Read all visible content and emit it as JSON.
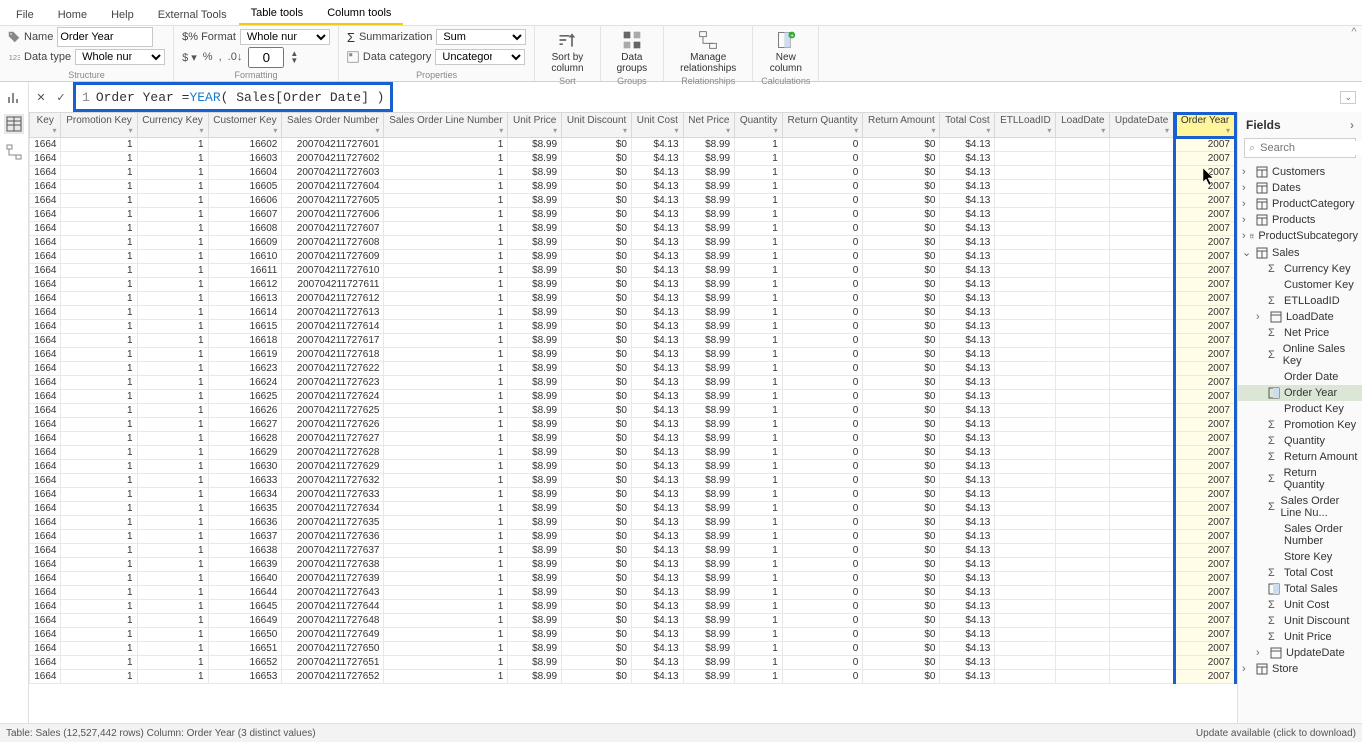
{
  "menuTabs": [
    {
      "label": "File"
    },
    {
      "label": "Home"
    },
    {
      "label": "Help"
    },
    {
      "label": "External Tools"
    },
    {
      "label": "Table tools",
      "active": true
    },
    {
      "label": "Column tools",
      "open": true
    }
  ],
  "ribbon": {
    "name": {
      "label": "Name",
      "value": "Order Year"
    },
    "dataType": {
      "label": "Data type",
      "value": "Whole number"
    },
    "formatLbl": "Format",
    "formatVal": "Whole number",
    "decimals": "0",
    "summarization": {
      "label": "Summarization",
      "value": "Sum"
    },
    "dataCategory": {
      "label": "Data category",
      "value": "Uncategorized"
    },
    "sortBy": "Sort by\ncolumn",
    "sortGrp": "Sort",
    "dataGroups": "Data\ngroups",
    "groupsGrp": "Groups",
    "manageRel": "Manage\nrelationships",
    "relGrp": "Relationships",
    "newCol": "New\ncolumn",
    "calcGrp": "Calculations",
    "structureGrp": "Structure",
    "formattingGrp": "Formatting",
    "propertiesGrp": "Properties"
  },
  "formula": {
    "line": "1",
    "prefix": "Order Year = ",
    "fn": "YEAR",
    "arg": " ( Sales[Order Date] )"
  },
  "columns": [
    "Key",
    "Promotion Key",
    "Currency Key",
    "Customer Key",
    "Sales Order Number",
    "Sales Order Line Number",
    "Unit Price",
    "Unit Discount",
    "Unit Cost",
    "Net Price",
    "Quantity",
    "Return Quantity",
    "Return Amount",
    "Total Cost",
    "ETLLoadID",
    "LoadDate",
    "UpdateDate",
    "Order Year"
  ],
  "rows": [
    [
      "1664",
      "1",
      "1",
      "16602",
      "200704211727601",
      "1",
      "$8.99",
      "$0",
      "$4.13",
      "$8.99",
      "1",
      "0",
      "$0",
      "$4.13",
      "",
      "",
      "",
      "2007"
    ],
    [
      "1664",
      "1",
      "1",
      "16603",
      "200704211727602",
      "1",
      "$8.99",
      "$0",
      "$4.13",
      "$8.99",
      "1",
      "0",
      "$0",
      "$4.13",
      "",
      "",
      "",
      "2007"
    ],
    [
      "1664",
      "1",
      "1",
      "16604",
      "200704211727603",
      "1",
      "$8.99",
      "$0",
      "$4.13",
      "$8.99",
      "1",
      "0",
      "$0",
      "$4.13",
      "",
      "",
      "",
      "2007"
    ],
    [
      "1664",
      "1",
      "1",
      "16605",
      "200704211727604",
      "1",
      "$8.99",
      "$0",
      "$4.13",
      "$8.99",
      "1",
      "0",
      "$0",
      "$4.13",
      "",
      "",
      "",
      "2007"
    ],
    [
      "1664",
      "1",
      "1",
      "16606",
      "200704211727605",
      "1",
      "$8.99",
      "$0",
      "$4.13",
      "$8.99",
      "1",
      "0",
      "$0",
      "$4.13",
      "",
      "",
      "",
      "2007"
    ],
    [
      "1664",
      "1",
      "1",
      "16607",
      "200704211727606",
      "1",
      "$8.99",
      "$0",
      "$4.13",
      "$8.99",
      "1",
      "0",
      "$0",
      "$4.13",
      "",
      "",
      "",
      "2007"
    ],
    [
      "1664",
      "1",
      "1",
      "16608",
      "200704211727607",
      "1",
      "$8.99",
      "$0",
      "$4.13",
      "$8.99",
      "1",
      "0",
      "$0",
      "$4.13",
      "",
      "",
      "",
      "2007"
    ],
    [
      "1664",
      "1",
      "1",
      "16609",
      "200704211727608",
      "1",
      "$8.99",
      "$0",
      "$4.13",
      "$8.99",
      "1",
      "0",
      "$0",
      "$4.13",
      "",
      "",
      "",
      "2007"
    ],
    [
      "1664",
      "1",
      "1",
      "16610",
      "200704211727609",
      "1",
      "$8.99",
      "$0",
      "$4.13",
      "$8.99",
      "1",
      "0",
      "$0",
      "$4.13",
      "",
      "",
      "",
      "2007"
    ],
    [
      "1664",
      "1",
      "1",
      "16611",
      "200704211727610",
      "1",
      "$8.99",
      "$0",
      "$4.13",
      "$8.99",
      "1",
      "0",
      "$0",
      "$4.13",
      "",
      "",
      "",
      "2007"
    ],
    [
      "1664",
      "1",
      "1",
      "16612",
      "200704211727611",
      "1",
      "$8.99",
      "$0",
      "$4.13",
      "$8.99",
      "1",
      "0",
      "$0",
      "$4.13",
      "",
      "",
      "",
      "2007"
    ],
    [
      "1664",
      "1",
      "1",
      "16613",
      "200704211727612",
      "1",
      "$8.99",
      "$0",
      "$4.13",
      "$8.99",
      "1",
      "0",
      "$0",
      "$4.13",
      "",
      "",
      "",
      "2007"
    ],
    [
      "1664",
      "1",
      "1",
      "16614",
      "200704211727613",
      "1",
      "$8.99",
      "$0",
      "$4.13",
      "$8.99",
      "1",
      "0",
      "$0",
      "$4.13",
      "",
      "",
      "",
      "2007"
    ],
    [
      "1664",
      "1",
      "1",
      "16615",
      "200704211727614",
      "1",
      "$8.99",
      "$0",
      "$4.13",
      "$8.99",
      "1",
      "0",
      "$0",
      "$4.13",
      "",
      "",
      "",
      "2007"
    ],
    [
      "1664",
      "1",
      "1",
      "16618",
      "200704211727617",
      "1",
      "$8.99",
      "$0",
      "$4.13",
      "$8.99",
      "1",
      "0",
      "$0",
      "$4.13",
      "",
      "",
      "",
      "2007"
    ],
    [
      "1664",
      "1",
      "1",
      "16619",
      "200704211727618",
      "1",
      "$8.99",
      "$0",
      "$4.13",
      "$8.99",
      "1",
      "0",
      "$0",
      "$4.13",
      "",
      "",
      "",
      "2007"
    ],
    [
      "1664",
      "1",
      "1",
      "16623",
      "200704211727622",
      "1",
      "$8.99",
      "$0",
      "$4.13",
      "$8.99",
      "1",
      "0",
      "$0",
      "$4.13",
      "",
      "",
      "",
      "2007"
    ],
    [
      "1664",
      "1",
      "1",
      "16624",
      "200704211727623",
      "1",
      "$8.99",
      "$0",
      "$4.13",
      "$8.99",
      "1",
      "0",
      "$0",
      "$4.13",
      "",
      "",
      "",
      "2007"
    ],
    [
      "1664",
      "1",
      "1",
      "16625",
      "200704211727624",
      "1",
      "$8.99",
      "$0",
      "$4.13",
      "$8.99",
      "1",
      "0",
      "$0",
      "$4.13",
      "",
      "",
      "",
      "2007"
    ],
    [
      "1664",
      "1",
      "1",
      "16626",
      "200704211727625",
      "1",
      "$8.99",
      "$0",
      "$4.13",
      "$8.99",
      "1",
      "0",
      "$0",
      "$4.13",
      "",
      "",
      "",
      "2007"
    ],
    [
      "1664",
      "1",
      "1",
      "16627",
      "200704211727626",
      "1",
      "$8.99",
      "$0",
      "$4.13",
      "$8.99",
      "1",
      "0",
      "$0",
      "$4.13",
      "",
      "",
      "",
      "2007"
    ],
    [
      "1664",
      "1",
      "1",
      "16628",
      "200704211727627",
      "1",
      "$8.99",
      "$0",
      "$4.13",
      "$8.99",
      "1",
      "0",
      "$0",
      "$4.13",
      "",
      "",
      "",
      "2007"
    ],
    [
      "1664",
      "1",
      "1",
      "16629",
      "200704211727628",
      "1",
      "$8.99",
      "$0",
      "$4.13",
      "$8.99",
      "1",
      "0",
      "$0",
      "$4.13",
      "",
      "",
      "",
      "2007"
    ],
    [
      "1664",
      "1",
      "1",
      "16630",
      "200704211727629",
      "1",
      "$8.99",
      "$0",
      "$4.13",
      "$8.99",
      "1",
      "0",
      "$0",
      "$4.13",
      "",
      "",
      "",
      "2007"
    ],
    [
      "1664",
      "1",
      "1",
      "16633",
      "200704211727632",
      "1",
      "$8.99",
      "$0",
      "$4.13",
      "$8.99",
      "1",
      "0",
      "$0",
      "$4.13",
      "",
      "",
      "",
      "2007"
    ],
    [
      "1664",
      "1",
      "1",
      "16634",
      "200704211727633",
      "1",
      "$8.99",
      "$0",
      "$4.13",
      "$8.99",
      "1",
      "0",
      "$0",
      "$4.13",
      "",
      "",
      "",
      "2007"
    ],
    [
      "1664",
      "1",
      "1",
      "16635",
      "200704211727634",
      "1",
      "$8.99",
      "$0",
      "$4.13",
      "$8.99",
      "1",
      "0",
      "$0",
      "$4.13",
      "",
      "",
      "",
      "2007"
    ],
    [
      "1664",
      "1",
      "1",
      "16636",
      "200704211727635",
      "1",
      "$8.99",
      "$0",
      "$4.13",
      "$8.99",
      "1",
      "0",
      "$0",
      "$4.13",
      "",
      "",
      "",
      "2007"
    ],
    [
      "1664",
      "1",
      "1",
      "16637",
      "200704211727636",
      "1",
      "$8.99",
      "$0",
      "$4.13",
      "$8.99",
      "1",
      "0",
      "$0",
      "$4.13",
      "",
      "",
      "",
      "2007"
    ],
    [
      "1664",
      "1",
      "1",
      "16638",
      "200704211727637",
      "1",
      "$8.99",
      "$0",
      "$4.13",
      "$8.99",
      "1",
      "0",
      "$0",
      "$4.13",
      "",
      "",
      "",
      "2007"
    ],
    [
      "1664",
      "1",
      "1",
      "16639",
      "200704211727638",
      "1",
      "$8.99",
      "$0",
      "$4.13",
      "$8.99",
      "1",
      "0",
      "$0",
      "$4.13",
      "",
      "",
      "",
      "2007"
    ],
    [
      "1664",
      "1",
      "1",
      "16640",
      "200704211727639",
      "1",
      "$8.99",
      "$0",
      "$4.13",
      "$8.99",
      "1",
      "0",
      "$0",
      "$4.13",
      "",
      "",
      "",
      "2007"
    ],
    [
      "1664",
      "1",
      "1",
      "16644",
      "200704211727643",
      "1",
      "$8.99",
      "$0",
      "$4.13",
      "$8.99",
      "1",
      "0",
      "$0",
      "$4.13",
      "",
      "",
      "",
      "2007"
    ],
    [
      "1664",
      "1",
      "1",
      "16645",
      "200704211727644",
      "1",
      "$8.99",
      "$0",
      "$4.13",
      "$8.99",
      "1",
      "0",
      "$0",
      "$4.13",
      "",
      "",
      "",
      "2007"
    ],
    [
      "1664",
      "1",
      "1",
      "16649",
      "200704211727648",
      "1",
      "$8.99",
      "$0",
      "$4.13",
      "$8.99",
      "1",
      "0",
      "$0",
      "$4.13",
      "",
      "",
      "",
      "2007"
    ],
    [
      "1664",
      "1",
      "1",
      "16650",
      "200704211727649",
      "1",
      "$8.99",
      "$0",
      "$4.13",
      "$8.99",
      "1",
      "0",
      "$0",
      "$4.13",
      "",
      "",
      "",
      "2007"
    ],
    [
      "1664",
      "1",
      "1",
      "16651",
      "200704211727650",
      "1",
      "$8.99",
      "$0",
      "$4.13",
      "$8.99",
      "1",
      "0",
      "$0",
      "$4.13",
      "",
      "",
      "",
      "2007"
    ],
    [
      "1664",
      "1",
      "1",
      "16652",
      "200704211727651",
      "1",
      "$8.99",
      "$0",
      "$4.13",
      "$8.99",
      "1",
      "0",
      "$0",
      "$4.13",
      "",
      "",
      "",
      "2007"
    ],
    [
      "1664",
      "1",
      "1",
      "16653",
      "200704211727652",
      "1",
      "$8.99",
      "$0",
      "$4.13",
      "$8.99",
      "1",
      "0",
      "$0",
      "$4.13",
      "",
      "",
      "",
      "2007"
    ]
  ],
  "fields": {
    "title": "Fields",
    "search": "Search",
    "tables": [
      {
        "name": "Customers",
        "exp": false
      },
      {
        "name": "Dates",
        "exp": false
      },
      {
        "name": "ProductCategory",
        "exp": false
      },
      {
        "name": "Products",
        "exp": false
      },
      {
        "name": "ProductSubcategory",
        "exp": false
      },
      {
        "name": "Sales",
        "exp": true,
        "cols": [
          {
            "name": "Currency Key",
            "ico": "sigma"
          },
          {
            "name": "Customer Key"
          },
          {
            "name": "ETLLoadID",
            "ico": "sigma"
          },
          {
            "name": "LoadDate",
            "ico": "table",
            "chev": true
          },
          {
            "name": "Net Price",
            "ico": "sigma"
          },
          {
            "name": "Online Sales Key",
            "ico": "sigma"
          },
          {
            "name": "Order Date"
          },
          {
            "name": "Order Year",
            "ico": "calc",
            "sel": true
          },
          {
            "name": "Product Key"
          },
          {
            "name": "Promotion Key",
            "ico": "sigma"
          },
          {
            "name": "Quantity",
            "ico": "sigma"
          },
          {
            "name": "Return Amount",
            "ico": "sigma"
          },
          {
            "name": "Return Quantity",
            "ico": "sigma"
          },
          {
            "name": "Sales Order Line Nu...",
            "ico": "sigma"
          },
          {
            "name": "Sales Order Number"
          },
          {
            "name": "Store Key"
          },
          {
            "name": "Total Cost",
            "ico": "sigma"
          },
          {
            "name": "Total Sales",
            "ico": "calc"
          },
          {
            "name": "Unit Cost",
            "ico": "sigma"
          },
          {
            "name": "Unit Discount",
            "ico": "sigma"
          },
          {
            "name": "Unit Price",
            "ico": "sigma"
          },
          {
            "name": "UpdateDate",
            "ico": "table",
            "chev": true
          }
        ]
      },
      {
        "name": "Store",
        "exp": false
      }
    ]
  },
  "status": {
    "left": "Table: Sales (12,527,442 rows) Column: Order Year (3 distinct values)",
    "right": "Update available (click to download)"
  }
}
